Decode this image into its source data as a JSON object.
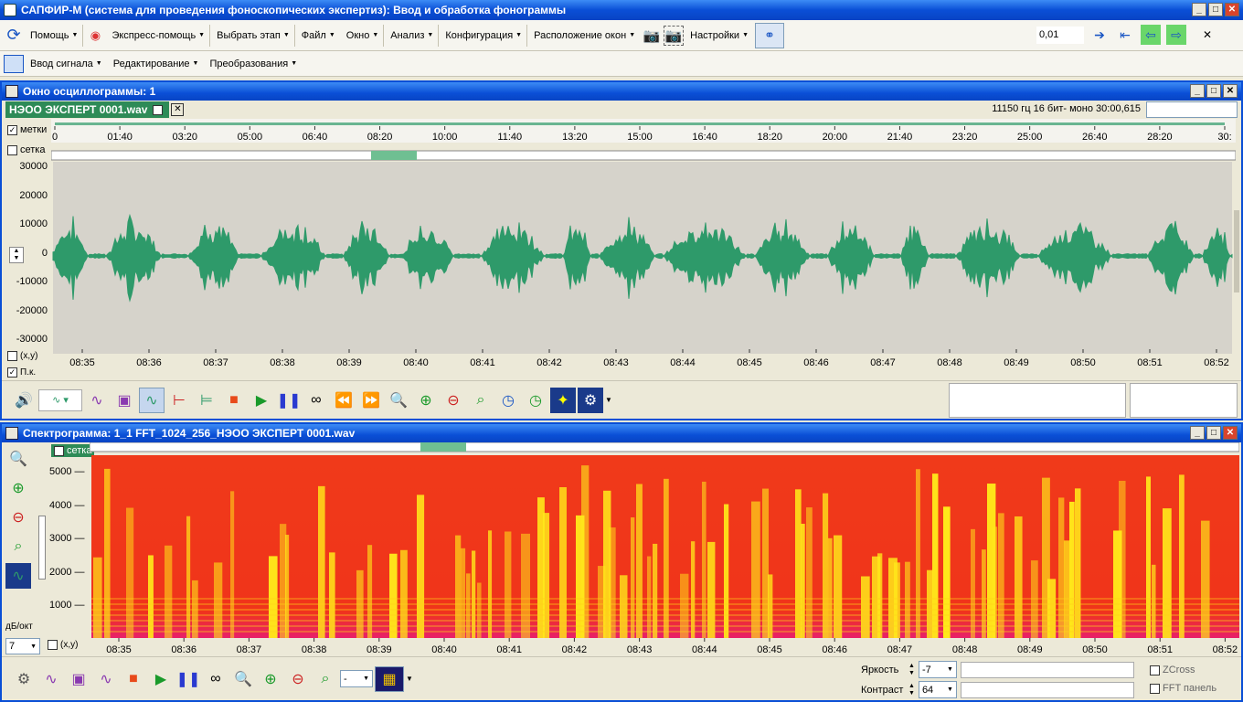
{
  "app": {
    "title": "САПФИР-М (система для проведения фоноскопических экспертиз): Ввод и обработка фонограммы",
    "win_min": "_",
    "win_max": "□",
    "win_close": "✕"
  },
  "toolbar1": {
    "help": "Помощь",
    "express_help": "Экспресс-помощь",
    "choose_stage": "Выбрать этап",
    "file": "Файл",
    "window": "Окно",
    "analysis": "Анализ",
    "configuration": "Конфигурация",
    "window_layout": "Расположение окон",
    "settings": "Настройки",
    "step_value": "0,01",
    "close_glyph": "✕"
  },
  "toolbar2": {
    "signal_input": "Ввод сигнала",
    "editing": "Редактирование",
    "transform": "Преобразования"
  },
  "osc": {
    "title": "Окно осциллограммы: 1",
    "file_tab": "НЭОО ЭКСПЕРТ 0001.wav",
    "file_info": "11150 гц 16 бит- моно 30:00,615",
    "marks_label": "метки",
    "grid_label": "сетка",
    "xy_label": "(x,y)",
    "pk_label": "П.к.",
    "overview_ticks": [
      "0",
      "01:40",
      "03:20",
      "05:00",
      "06:40",
      "08:20",
      "10:00",
      "11:40",
      "13:20",
      "15:00",
      "16:40",
      "18:20",
      "20:00",
      "21:40",
      "23:20",
      "25:00",
      "26:40",
      "28:20",
      "30:"
    ],
    "y_ticks": [
      "30000",
      "20000",
      "10000",
      "0",
      "-10000",
      "-20000",
      "-30000"
    ],
    "time_ticks": [
      "08:35",
      "08:36",
      "08:37",
      "08:38",
      "08:39",
      "08:40",
      "08:41",
      "08:42",
      "08:43",
      "08:44",
      "08:45",
      "08:46",
      "08:47",
      "08:48",
      "08:49",
      "08:50",
      "08:51",
      "08:52"
    ],
    "wave_color": "#2e9a6a",
    "bg_color": "#d6d3cb"
  },
  "spec": {
    "title": "Спектрограмма: 1_1  FFT_1024_256_НЭОО ЭКСПЕРТ 0001.wav",
    "grid_label": "сетка",
    "db_label": "дБ/окт",
    "db_value": "7",
    "xy_label": "(x,y)",
    "y_ticks": [
      "5000",
      "4000",
      "3000",
      "2000",
      "1000"
    ],
    "time_ticks": [
      "08:35",
      "08:36",
      "08:37",
      "08:38",
      "08:39",
      "08:40",
      "08:41",
      "08:42",
      "08:43",
      "08:44",
      "08:45",
      "08:46",
      "08:47",
      "08:48",
      "08:49",
      "08:50",
      "08:51",
      "08:52"
    ],
    "brightness_label": "Яркость",
    "brightness_value": "-7",
    "contrast_label": "Контраст",
    "contrast_value": "64",
    "zcross_label": "ZCross",
    "fft_panel_label": "FFT панель",
    "dash_value": "-"
  }
}
